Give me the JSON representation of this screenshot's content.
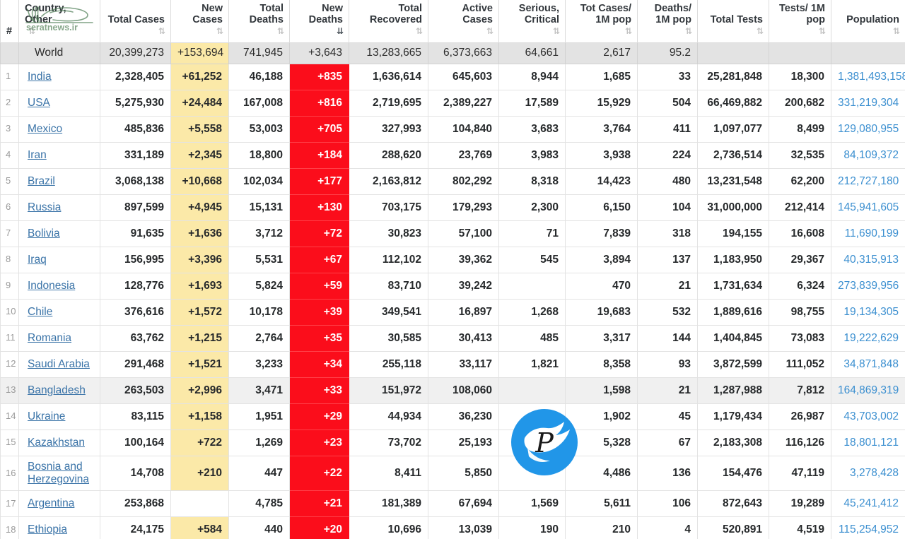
{
  "table": {
    "columns": [
      {
        "key": "rank",
        "label": "#",
        "align": "left",
        "sort": "none"
      },
      {
        "key": "country",
        "label": "Country, Other",
        "align": "left",
        "sort": "both"
      },
      {
        "key": "total_cases",
        "label": "Total Cases",
        "align": "right",
        "sort": "both"
      },
      {
        "key": "new_cases",
        "label": "New Cases",
        "align": "right",
        "sort": "both"
      },
      {
        "key": "total_deaths",
        "label": "Total Deaths",
        "align": "right",
        "sort": "both"
      },
      {
        "key": "new_deaths",
        "label": "New Deaths",
        "align": "right",
        "sort": "desc"
      },
      {
        "key": "total_recovered",
        "label": "Total Recovered",
        "align": "right",
        "sort": "both"
      },
      {
        "key": "active_cases",
        "label": "Active Cases",
        "align": "right",
        "sort": "both"
      },
      {
        "key": "serious_critical",
        "label": "Serious, Critical",
        "align": "right",
        "sort": "both"
      },
      {
        "key": "cases_per_1m",
        "label": "Tot Cases/ 1M pop",
        "align": "right",
        "sort": "both"
      },
      {
        "key": "deaths_per_1m",
        "label": "Deaths/ 1M pop",
        "align": "right",
        "sort": "both"
      },
      {
        "key": "total_tests",
        "label": "Total Tests",
        "align": "right",
        "sort": "both"
      },
      {
        "key": "tests_per_1m",
        "label": "Tests/ 1M pop",
        "align": "right",
        "sort": "both"
      },
      {
        "key": "population",
        "label": "Population",
        "align": "right",
        "sort": "both"
      }
    ],
    "sort_icon_both": "⇅",
    "sort_icon_desc": "⇊",
    "world_row": {
      "rank": "",
      "country": "World",
      "total_cases": "20,399,273",
      "new_cases": "+153,694",
      "total_deaths": "741,945",
      "new_deaths": "+3,643",
      "total_recovered": "13,283,665",
      "active_cases": "6,373,663",
      "serious_critical": "64,661",
      "cases_per_1m": "2,617",
      "deaths_per_1m": "95.2",
      "total_tests": "",
      "tests_per_1m": "",
      "population": ""
    },
    "rows": [
      {
        "rank": "1",
        "country": "India",
        "total_cases": "2,328,405",
        "new_cases": "+61,252",
        "total_deaths": "46,188",
        "new_deaths": "+835",
        "total_recovered": "1,636,614",
        "active_cases": "645,603",
        "serious_critical": "8,944",
        "cases_per_1m": "1,685",
        "deaths_per_1m": "33",
        "total_tests": "25,281,848",
        "tests_per_1m": "18,300",
        "population": "1,381,493,158",
        "highlight": false
      },
      {
        "rank": "2",
        "country": "USA",
        "total_cases": "5,275,930",
        "new_cases": "+24,484",
        "total_deaths": "167,008",
        "new_deaths": "+816",
        "total_recovered": "2,719,695",
        "active_cases": "2,389,227",
        "serious_critical": "17,589",
        "cases_per_1m": "15,929",
        "deaths_per_1m": "504",
        "total_tests": "66,469,882",
        "tests_per_1m": "200,682",
        "population": "331,219,304",
        "highlight": false
      },
      {
        "rank": "3",
        "country": "Mexico",
        "total_cases": "485,836",
        "new_cases": "+5,558",
        "total_deaths": "53,003",
        "new_deaths": "+705",
        "total_recovered": "327,993",
        "active_cases": "104,840",
        "serious_critical": "3,683",
        "cases_per_1m": "3,764",
        "deaths_per_1m": "411",
        "total_tests": "1,097,077",
        "tests_per_1m": "8,499",
        "population": "129,080,955",
        "highlight": false
      },
      {
        "rank": "4",
        "country": "Iran",
        "total_cases": "331,189",
        "new_cases": "+2,345",
        "total_deaths": "18,800",
        "new_deaths": "+184",
        "total_recovered": "288,620",
        "active_cases": "23,769",
        "serious_critical": "3,983",
        "cases_per_1m": "3,938",
        "deaths_per_1m": "224",
        "total_tests": "2,736,514",
        "tests_per_1m": "32,535",
        "population": "84,109,372",
        "highlight": false
      },
      {
        "rank": "5",
        "country": "Brazil",
        "total_cases": "3,068,138",
        "new_cases": "+10,668",
        "total_deaths": "102,034",
        "new_deaths": "+177",
        "total_recovered": "2,163,812",
        "active_cases": "802,292",
        "serious_critical": "8,318",
        "cases_per_1m": "14,423",
        "deaths_per_1m": "480",
        "total_tests": "13,231,548",
        "tests_per_1m": "62,200",
        "population": "212,727,180",
        "highlight": false
      },
      {
        "rank": "6",
        "country": "Russia",
        "total_cases": "897,599",
        "new_cases": "+4,945",
        "total_deaths": "15,131",
        "new_deaths": "+130",
        "total_recovered": "703,175",
        "active_cases": "179,293",
        "serious_critical": "2,300",
        "cases_per_1m": "6,150",
        "deaths_per_1m": "104",
        "total_tests": "31,000,000",
        "tests_per_1m": "212,414",
        "population": "145,941,605",
        "highlight": false
      },
      {
        "rank": "7",
        "country": "Bolivia",
        "total_cases": "91,635",
        "new_cases": "+1,636",
        "total_deaths": "3,712",
        "new_deaths": "+72",
        "total_recovered": "30,823",
        "active_cases": "57,100",
        "serious_critical": "71",
        "cases_per_1m": "7,839",
        "deaths_per_1m": "318",
        "total_tests": "194,155",
        "tests_per_1m": "16,608",
        "population": "11,690,199",
        "highlight": false
      },
      {
        "rank": "8",
        "country": "Iraq",
        "total_cases": "156,995",
        "new_cases": "+3,396",
        "total_deaths": "5,531",
        "new_deaths": "+67",
        "total_recovered": "112,102",
        "active_cases": "39,362",
        "serious_critical": "545",
        "cases_per_1m": "3,894",
        "deaths_per_1m": "137",
        "total_tests": "1,183,950",
        "tests_per_1m": "29,367",
        "population": "40,315,913",
        "highlight": false
      },
      {
        "rank": "9",
        "country": "Indonesia",
        "total_cases": "128,776",
        "new_cases": "+1,693",
        "total_deaths": "5,824",
        "new_deaths": "+59",
        "total_recovered": "83,710",
        "active_cases": "39,242",
        "serious_critical": "",
        "cases_per_1m": "470",
        "deaths_per_1m": "21",
        "total_tests": "1,731,634",
        "tests_per_1m": "6,324",
        "population": "273,839,956",
        "highlight": false
      },
      {
        "rank": "10",
        "country": "Chile",
        "total_cases": "376,616",
        "new_cases": "+1,572",
        "total_deaths": "10,178",
        "new_deaths": "+39",
        "total_recovered": "349,541",
        "active_cases": "16,897",
        "serious_critical": "1,268",
        "cases_per_1m": "19,683",
        "deaths_per_1m": "532",
        "total_tests": "1,889,616",
        "tests_per_1m": "98,755",
        "population": "19,134,305",
        "highlight": false
      },
      {
        "rank": "11",
        "country": "Romania",
        "total_cases": "63,762",
        "new_cases": "+1,215",
        "total_deaths": "2,764",
        "new_deaths": "+35",
        "total_recovered": "30,585",
        "active_cases": "30,413",
        "serious_critical": "485",
        "cases_per_1m": "3,317",
        "deaths_per_1m": "144",
        "total_tests": "1,404,845",
        "tests_per_1m": "73,083",
        "population": "19,222,629",
        "highlight": false
      },
      {
        "rank": "12",
        "country": "Saudi Arabia",
        "total_cases": "291,468",
        "new_cases": "+1,521",
        "total_deaths": "3,233",
        "new_deaths": "+34",
        "total_recovered": "255,118",
        "active_cases": "33,117",
        "serious_critical": "1,821",
        "cases_per_1m": "8,358",
        "deaths_per_1m": "93",
        "total_tests": "3,872,599",
        "tests_per_1m": "111,052",
        "population": "34,871,848",
        "highlight": false
      },
      {
        "rank": "13",
        "country": "Bangladesh",
        "total_cases": "263,503",
        "new_cases": "+2,996",
        "total_deaths": "3,471",
        "new_deaths": "+33",
        "total_recovered": "151,972",
        "active_cases": "108,060",
        "serious_critical": "",
        "cases_per_1m": "1,598",
        "deaths_per_1m": "21",
        "total_tests": "1,287,988",
        "tests_per_1m": "7,812",
        "population": "164,869,319",
        "highlight": true
      },
      {
        "rank": "14",
        "country": "Ukraine",
        "total_cases": "83,115",
        "new_cases": "+1,158",
        "total_deaths": "1,951",
        "new_deaths": "+29",
        "total_recovered": "44,934",
        "active_cases": "36,230",
        "serious_critical": "132",
        "cases_per_1m": "1,902",
        "deaths_per_1m": "45",
        "total_tests": "1,179,434",
        "tests_per_1m": "26,987",
        "population": "43,703,002",
        "highlight": false
      },
      {
        "rank": "15",
        "country": "Kazakhstan",
        "total_cases": "100,164",
        "new_cases": "+722",
        "total_deaths": "1,269",
        "new_deaths": "+23",
        "total_recovered": "73,702",
        "active_cases": "25,193",
        "serious_critical": "",
        "cases_per_1m": "5,328",
        "deaths_per_1m": "67",
        "total_tests": "2,183,308",
        "tests_per_1m": "116,126",
        "population": "18,801,121",
        "highlight": false
      },
      {
        "rank": "16",
        "country": "Bosnia and Herzegovina",
        "total_cases": "14,708",
        "new_cases": "+210",
        "total_deaths": "447",
        "new_deaths": "+22",
        "total_recovered": "8,411",
        "active_cases": "5,850",
        "serious_critical": "",
        "cases_per_1m": "4,486",
        "deaths_per_1m": "136",
        "total_tests": "154,476",
        "tests_per_1m": "47,119",
        "population": "3,278,428",
        "highlight": false
      },
      {
        "rank": "17",
        "country": "Argentina",
        "total_cases": "253,868",
        "new_cases": "",
        "total_deaths": "4,785",
        "new_deaths": "+21",
        "total_recovered": "181,389",
        "active_cases": "67,694",
        "serious_critical": "1,569",
        "cases_per_1m": "5,611",
        "deaths_per_1m": "106",
        "total_tests": "872,643",
        "tests_per_1m": "19,289",
        "population": "45,241,412",
        "highlight": false
      },
      {
        "rank": "18",
        "country": "Ethiopia",
        "total_cases": "24,175",
        "new_cases": "+584",
        "total_deaths": "440",
        "new_deaths": "+20",
        "total_recovered": "10,696",
        "active_cases": "13,039",
        "serious_critical": "190",
        "cases_per_1m": "210",
        "deaths_per_1m": "4",
        "total_tests": "520,891",
        "tests_per_1m": "4,519",
        "population": "115,254,952",
        "highlight": false
      }
    ]
  },
  "watermarks": {
    "header_text": "seratnews.ir",
    "logo_letter": "P"
  },
  "colors": {
    "new_cases_bg": "#fbe9a8",
    "new_deaths_bg": "#fb0d1b",
    "link": "#3b74a8",
    "population": "#3b8fd0",
    "world_row_bg": "#e3e3e3",
    "watermark_green": "#4f7f55",
    "logo_blue": "#2196e8"
  }
}
